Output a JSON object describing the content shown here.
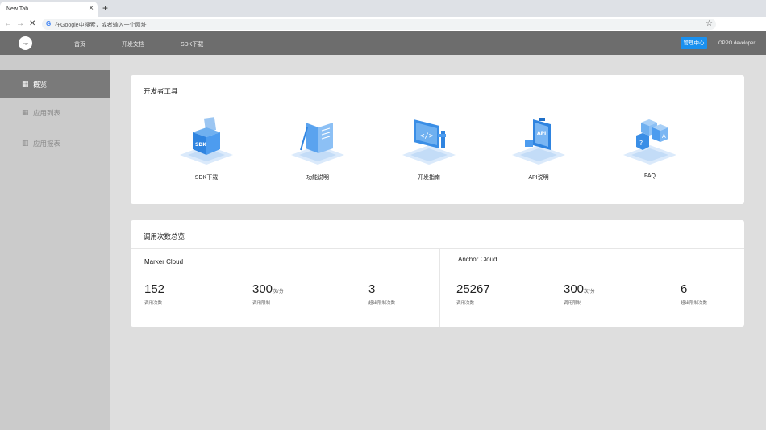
{
  "browser": {
    "tab_title": "New Tab",
    "tab_close": "×",
    "new_tab": "+",
    "back": "←",
    "forward": "→",
    "stop": "✕",
    "omnibox_g": "G",
    "omnibox_placeholder": "在Google中搜索，或者输入一个网址",
    "bookmark": "☆"
  },
  "header": {
    "logo": "logo",
    "nav": [
      "首页",
      "开发文档",
      "SDK下载"
    ],
    "admin_button": "管理中心",
    "developer_label": "OPPO developer"
  },
  "sidebar": {
    "items": [
      {
        "icon": "grid-icon",
        "glyph": "▦",
        "label": "概览",
        "active": true
      },
      {
        "icon": "grid-icon",
        "glyph": "▦",
        "label": "应用列表",
        "active": false
      },
      {
        "icon": "bar-chart-icon",
        "glyph": "▥",
        "label": "应用报表",
        "active": false
      }
    ]
  },
  "tools_card": {
    "title": "开发者工具",
    "tools": [
      {
        "label": "SDK下载",
        "icon": "sdk-box-icon"
      },
      {
        "label": "功能说明",
        "icon": "book-icon"
      },
      {
        "label": "开发指南",
        "icon": "code-screen-icon"
      },
      {
        "label": "API说明",
        "icon": "api-clipboard-icon"
      },
      {
        "label": "FAQ",
        "icon": "faq-cubes-icon"
      }
    ]
  },
  "usage_card": {
    "title": "调用次数总览",
    "panels": [
      {
        "title": "Marker Cloud",
        "stats": [
          {
            "value": "152",
            "unit": "",
            "label": "调用次数"
          },
          {
            "value": "300",
            "unit": "次/分",
            "label": "调用限制"
          },
          {
            "value": "3",
            "unit": "",
            "label": "超出限制次数"
          }
        ]
      },
      {
        "title": "Anchor Cloud",
        "stats": [
          {
            "value": "25267",
            "unit": "",
            "label": "调用次数"
          },
          {
            "value": "300",
            "unit": "次/分",
            "label": "调用限制"
          },
          {
            "value": "6",
            "unit": "",
            "label": "超出限制次数"
          }
        ]
      }
    ]
  },
  "colors": {
    "accent": "#1a90ef",
    "header_bg": "#6d6d6d",
    "sidebar_bg": "#cbcbcb",
    "sidebar_active": "#7a7a7a",
    "illustration_blue": "#3a8ee6"
  }
}
